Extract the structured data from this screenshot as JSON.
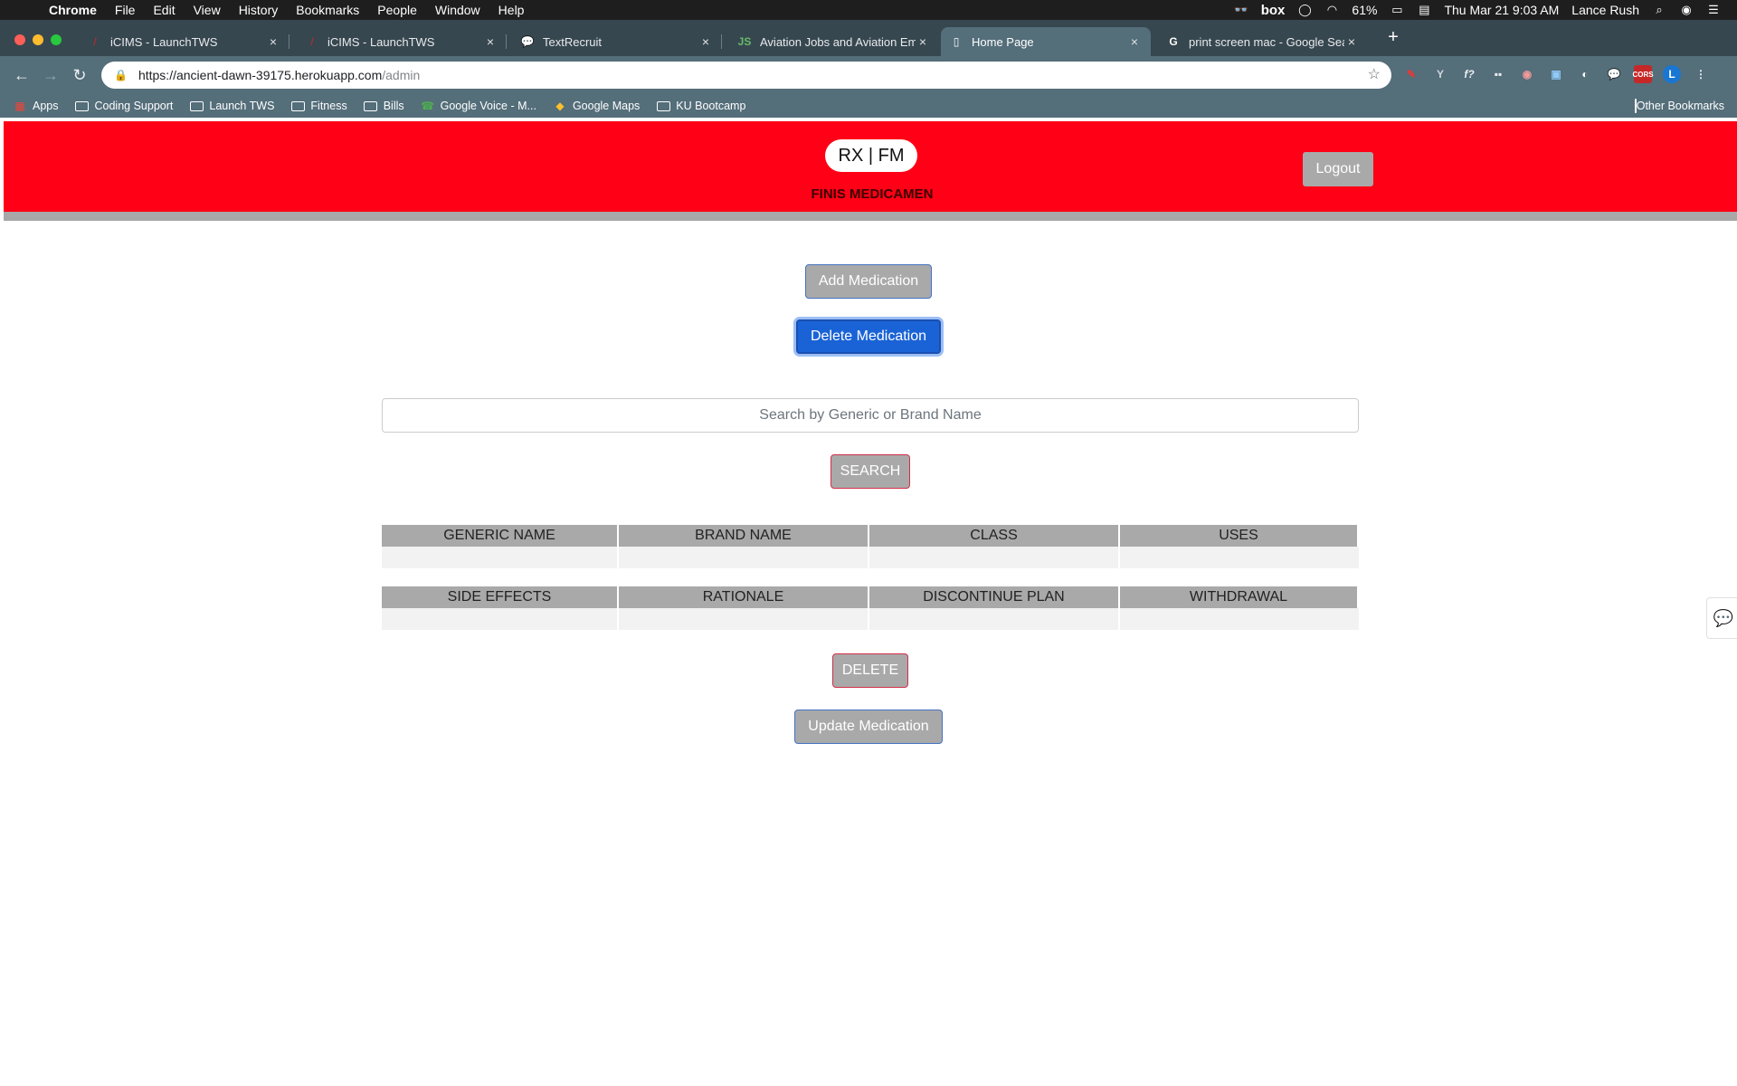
{
  "menubar": {
    "items": [
      "Chrome",
      "File",
      "Edit",
      "View",
      "History",
      "Bookmarks",
      "People",
      "Window",
      "Help"
    ],
    "battery": "61%",
    "datetime": "Thu Mar 21  9:03 AM",
    "user": "Lance Rush",
    "box_label": "box"
  },
  "tabs": [
    {
      "title": "iCIMS - LaunchTWS",
      "favicon": "icims-icon",
      "color": "#c62828"
    },
    {
      "title": "iCIMS - LaunchTWS",
      "favicon": "icims-icon",
      "color": "#c62828"
    },
    {
      "title": "TextRecruit",
      "favicon": "chat-icon",
      "color": "#4caf50"
    },
    {
      "title": "Aviation Jobs and Aviation Emp",
      "favicon": "js-icon",
      "color": "#2e7d32"
    },
    {
      "title": "Home Page",
      "favicon": "page-icon",
      "color": "#ffffff",
      "active": true
    },
    {
      "title": "print screen mac - Google Sea",
      "favicon": "google-icon",
      "color": "#4285f4"
    }
  ],
  "address": {
    "host": "https://ancient-dawn-39175.herokuapp.com",
    "path": "/admin"
  },
  "bookmarks": [
    {
      "label": "Apps",
      "icon": "apps-grid-icon"
    },
    {
      "label": "Coding Support",
      "icon": "folder-icon"
    },
    {
      "label": "Launch TWS",
      "icon": "folder-icon"
    },
    {
      "label": "Fitness",
      "icon": "folder-icon"
    },
    {
      "label": "Bills",
      "icon": "folder-icon"
    },
    {
      "label": "Google Voice - M...",
      "icon": "phone-icon"
    },
    {
      "label": "Google Maps",
      "icon": "maps-icon"
    },
    {
      "label": "KU Bootcamp",
      "icon": "folder-icon"
    }
  ],
  "other_bookmarks": "Other Bookmarks",
  "extensions": {
    "profile_letter": "L",
    "ext_y": "Y",
    "ext_f": "f?",
    "ext_cors": "CORS"
  },
  "app": {
    "logo": "RX | FM",
    "brand": "FINIS MEDICAMEN",
    "logout": "Logout",
    "add_medication": "Add Medication",
    "delete_medication": "Delete Medication",
    "search_placeholder": "Search by Generic or Brand Name",
    "search_button": "SEARCH",
    "table1_headers": [
      "GENERIC NAME",
      "BRAND NAME",
      "CLASS",
      "USES"
    ],
    "table2_headers": [
      "SIDE EFFECTS",
      "RATIONALE",
      "DISCONTINUE PLAN",
      "WITHDRAWAL"
    ],
    "delete_button": "DELETE",
    "update_medication": "Update Medication",
    "header_color": "#ff0016",
    "primary_color": "#1a63d6"
  }
}
